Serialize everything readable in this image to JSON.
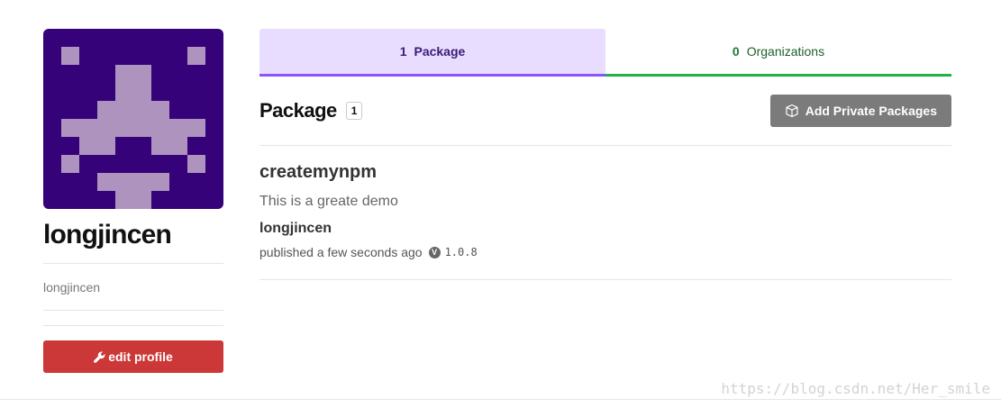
{
  "profile": {
    "avatar_colors": {
      "background": "#35027a",
      "pixel": "#ae93bf"
    },
    "display_name": "longjincen",
    "username": "longjincen",
    "edit_label": "edit profile"
  },
  "tabs": [
    {
      "count": "1",
      "label": "Package",
      "active": true
    },
    {
      "count": "0",
      "label": "Organizations",
      "active": false
    }
  ],
  "packages_section": {
    "title": "Package",
    "count": "1",
    "add_button_label": "Add Private Packages"
  },
  "packages": [
    {
      "name": "createmynpm",
      "description": "This is a greate demo",
      "author": "longjincen",
      "published": "published a few seconds ago",
      "version": "1.0.8"
    }
  ],
  "watermark": "https://blog.csdn.net/Her_smile",
  "colors": {
    "edit_button": "#cb3837",
    "packages_tab_bg": "#e8ddff",
    "packages_tab_border": "#8956ff",
    "orgs_tab_border": "#1fb34a",
    "add_button": "#7b7b7b"
  }
}
